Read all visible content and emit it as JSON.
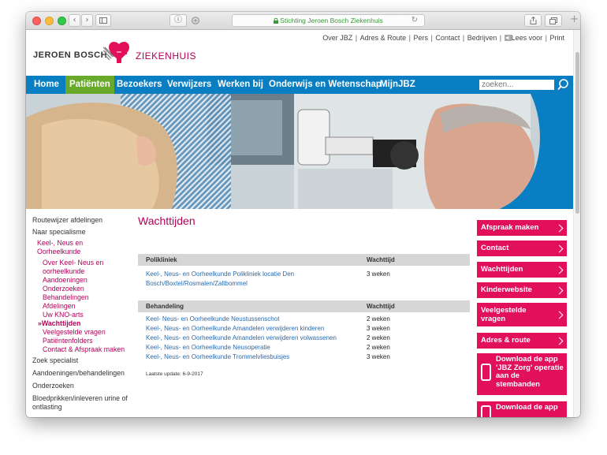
{
  "browser": {
    "url_text": "Stichting Jeroen Bosch Ziekenhuis",
    "lock_icon": "lock-icon",
    "nav_back": "‹",
    "nav_fwd": "›",
    "reader": "ⓘ",
    "reload": "↻",
    "new_tab": "+"
  },
  "header": {
    "logo_part1": "JEROEN BOSCH",
    "logo_part2": "ZIEKENHUIS",
    "toplinks": [
      "Over JBZ",
      "Adres & Route",
      "Pers",
      "Contact",
      "Bedrijven"
    ],
    "lees_voor": "Lees voor",
    "print": "Print"
  },
  "nav": {
    "items": [
      "Home",
      "Patiënten",
      "Bezoekers",
      "Verwijzers",
      "Werken bij",
      "Onderwijs en Wetenschap",
      "MijnJBZ"
    ],
    "active_index": 1,
    "search_placeholder": "zoeken..."
  },
  "sidebar": {
    "item_routewijzer": "Routewijzer afdelingen",
    "item_specialisme": "Naar specialisme",
    "item_keel": "Keel-, Neus en Oorheelkunde",
    "sub_items": [
      "Over Keel- Neus en oorheelkunde",
      "Aandoeningen",
      "Onderzoeken",
      "Behandelingen",
      "Afdelingen",
      "Uw KNO-arts"
    ],
    "current": "Wachttijden",
    "current_marker": "»",
    "sub_items_after": [
      "Veelgestelde vragen",
      "Patiëntenfolders",
      "Contact & Afspraak maken"
    ],
    "bottom_items": [
      "Zoek specialist",
      "Aandoeningen/behandelingen",
      "Onderzoeken",
      "Bloedprikken/inleveren urine of ontlasting"
    ]
  },
  "main": {
    "title": "Wachttijden",
    "table1": {
      "headers": [
        "Polikliniek",
        "Wachttijd"
      ],
      "rows": [
        {
          "name": "Keel-, Neus- en Oorheelkunde Polikliniek locatie Den Bosch/Boxtel/Rosmalen/Zaltbommel",
          "line1": "Keel-, Neus- en Oorheelkunde Polikliniek locatie Den",
          "line2": "Bosch/Boxtel/Rosmalen/Zaltbommel",
          "time": "3 weken"
        }
      ]
    },
    "table2": {
      "headers": [
        "Behandeling",
        "Wachttijd"
      ],
      "rows": [
        {
          "name": "Keel- Neus- en Oorheelkunde Neustussenschot",
          "time": "2 weken"
        },
        {
          "name": "Keel-, Neus- en Oorheelkunde Amandelen verwijderen kinderen",
          "time": "3 weken"
        },
        {
          "name": "Keel-, Neus- en Oorheelkunde Amandelen verwijderen volwassenen",
          "time": "2 weken"
        },
        {
          "name": "Keel-, Neus- en Oorheelkunde Neusoperatie",
          "time": "2 weken"
        },
        {
          "name": "Keel-, Neus- en Oorheelkunde Trommelvliesbuisjes",
          "time": "3 weken"
        }
      ]
    },
    "last_update": "Laatste update: 6-9-2017"
  },
  "right": {
    "buttons": [
      "Afspraak maken",
      "Contact",
      "Wachttijden",
      "Kinderwebsite",
      "Veelgestelde vragen",
      "Adres & route"
    ],
    "app1": "Download de app 'JBZ Zorg' operatie aan de stembanden",
    "app2": "Download de app"
  },
  "colors": {
    "brand_blue": "#0a7ec2",
    "brand_pink": "#e2105a",
    "active_green": "#6aaa2a",
    "heading_magenta": "#b5005a"
  }
}
